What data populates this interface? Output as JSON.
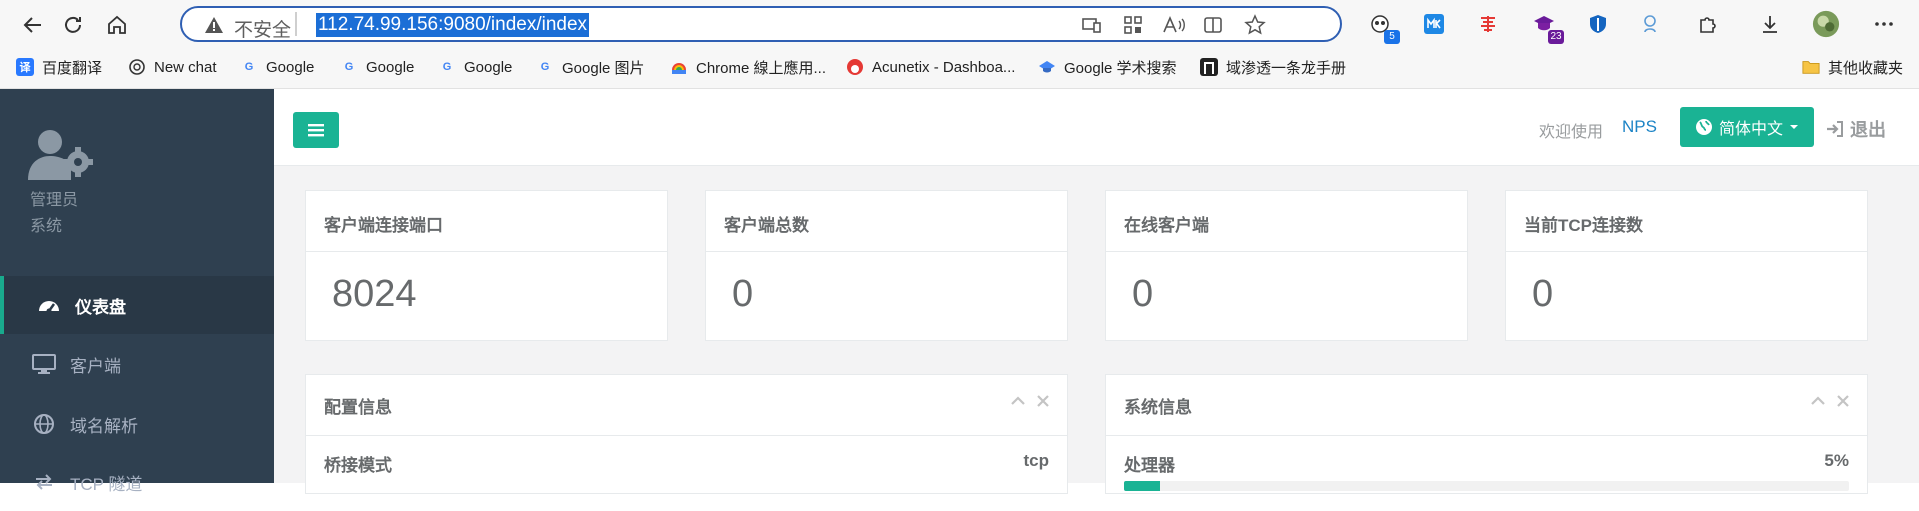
{
  "browser": {
    "address_insecure": "不安全",
    "url": "112.74.99.156:9080/index/index",
    "extension_badges": [
      "5",
      "23"
    ]
  },
  "bookmarks": [
    {
      "label": "百度翻译",
      "icon": "baidu-translate-icon",
      "color": "#2979ff"
    },
    {
      "label": "New chat",
      "icon": "openai-icon",
      "color": "#10a37f"
    },
    {
      "label": "Google",
      "icon": "google-icon",
      "color": "#4285f4"
    },
    {
      "label": "Google",
      "icon": "google-icon",
      "color": "#4285f4"
    },
    {
      "label": "Google",
      "icon": "google-icon",
      "color": "#4285f4"
    },
    {
      "label": "Google 图片",
      "icon": "google-icon",
      "color": "#4285f4"
    },
    {
      "label": "Chrome 線上應用...",
      "icon": "chrome-webstore-icon",
      "color": "#ea4335"
    },
    {
      "label": "Acunetix - Dashboa...",
      "icon": "acunetix-icon",
      "color": "#e53935"
    },
    {
      "label": "Google 学术搜索",
      "icon": "scholar-icon",
      "color": "#4285f4"
    },
    {
      "label": "域渗透一条龙手册",
      "icon": "site-icon",
      "color": "#222222"
    }
  ],
  "other_bookmarks": "其他收藏夹",
  "sidebar": {
    "admin_name": "管理员",
    "admin_role": "系统",
    "items": [
      {
        "label": "仪表盘",
        "icon": "dashboard-icon",
        "active": true
      },
      {
        "label": "客户端",
        "icon": "monitor-icon",
        "active": false
      },
      {
        "label": "域名解析",
        "icon": "globe-icon",
        "active": false
      },
      {
        "label": "TCP 隧道",
        "icon": "tunnel-icon",
        "active": false
      }
    ]
  },
  "header": {
    "welcome": "欢迎使用",
    "brand": "NPS",
    "language": "简体中文",
    "logout": "退出"
  },
  "stats": [
    {
      "title": "客户端连接端口",
      "value": "8024"
    },
    {
      "title": "客户端总数",
      "value": "0"
    },
    {
      "title": "在线客户端",
      "value": "0"
    },
    {
      "title": "当前TCP连接数",
      "value": "0"
    }
  ],
  "config_panel": {
    "title": "配置信息",
    "row_label": "桥接模式",
    "row_value": "tcp"
  },
  "system_panel": {
    "title": "系统信息",
    "row_label": "处理器",
    "row_value": "5%",
    "progress_percent": 5
  },
  "colors": {
    "accent": "#1ab394",
    "sidebar": "#2f4050",
    "link": "#1c84c6"
  }
}
